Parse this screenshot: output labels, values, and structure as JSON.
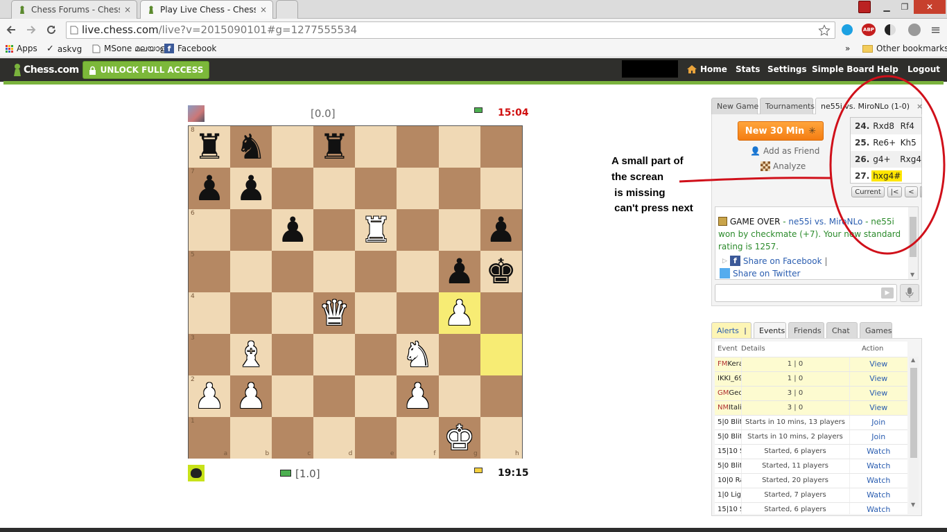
{
  "browser": {
    "tabs": [
      {
        "title": "Chess Forums - Chess.com",
        "close": "×"
      },
      {
        "title": "Play Live Chess - Chess.com",
        "close": "×"
      }
    ],
    "url_main": "live.chess.com",
    "url_rest": "/live?v=2015090101#g=1277555534",
    "window_min": "▁",
    "window_max": "❐",
    "window_close": "✕",
    "bookmarks": [
      "Apps",
      "askvg",
      "MSone മലയാളം",
      "Facebook"
    ],
    "overflow": "»",
    "other_bookmarks": "Other bookmarks"
  },
  "site": {
    "logo": "Chess.com",
    "unlock": "UNLOCK FULL ACCESS",
    "nav": [
      "Home",
      "Stats",
      "Settings",
      "Simple Board",
      "Help",
      "Logout"
    ]
  },
  "game": {
    "top_score": "[0.0]",
    "top_clock": "15:04",
    "bottom_score": "[1.0]",
    "bottom_clock": "19:15",
    "ranks": [
      "8",
      "7",
      "6",
      "5",
      "4",
      "3",
      "2",
      "1"
    ],
    "files": [
      "a",
      "b",
      "c",
      "d",
      "e",
      "f",
      "g",
      "h"
    ],
    "board": [
      [
        "r",
        "n",
        "",
        "r",
        "",
        "",
        "",
        ""
      ],
      [
        "p",
        "p",
        "",
        "",
        "",
        "",
        "",
        ""
      ],
      [
        "",
        "",
        "p",
        "",
        "R",
        "",
        "",
        "p"
      ],
      [
        "",
        "",
        "",
        "",
        "",
        "",
        "p",
        "k"
      ],
      [
        "",
        "",
        "",
        "Q",
        "",
        "",
        "P",
        ""
      ],
      [
        "",
        "B",
        "",
        "",
        "",
        "N",
        "",
        ""
      ],
      [
        "P",
        "P",
        "",
        "",
        "",
        "P",
        "",
        ""
      ],
      [
        "",
        "",
        "",
        "",
        "",
        "",
        "K",
        ""
      ]
    ],
    "highlight_squares": [
      "g4",
      "h3"
    ]
  },
  "panel": {
    "tabs": [
      "New Game",
      "Tournaments",
      "ne55i vs. MiroNLo (1-0)"
    ],
    "tab_close": "×",
    "new_button": "New 30 Min",
    "add_friend": "Add as Friend",
    "analyze": "Analyze",
    "moves": [
      {
        "n": "24.",
        "w": "Rxd8",
        "b": "Rf4"
      },
      {
        "n": "25.",
        "w": "Re6+",
        "b": "Kh5"
      },
      {
        "n": "26.",
        "w": "g4+",
        "b": "Rxg4"
      },
      {
        "n": "27.",
        "w": "hxg4#",
        "b": ""
      }
    ],
    "nav_current": "Current",
    "nav_first": "|<",
    "nav_prev": "<",
    "chat_game_over": "GAME OVER",
    "chat_dash": " - ",
    "chat_players": "ne55i vs. MiroNLo",
    "chat_result": " - ne55i won by checkmate (+7). Your new standard rating is 1257.",
    "share_facebook": "Share on Facebook",
    "share_sep": "|",
    "share_twitter": "Share on Twitter"
  },
  "events": {
    "tabs": [
      "Alerts",
      "Events",
      "Friends",
      "Chat",
      "Games"
    ],
    "headers": [
      "Event",
      "Details",
      "Action"
    ],
    "rows": [
      {
        "title": "FM",
        "name": "Kera",
        "details": "1 | 0",
        "action": "View",
        "hl": true
      },
      {
        "title": "",
        "name": "IKKI_69",
        "details": "1 | 0",
        "action": "View",
        "hl": true
      },
      {
        "title": "GM",
        "name": "Geo",
        "details": "3 | 0",
        "action": "View",
        "hl": true
      },
      {
        "title": "NM",
        "name": "Itali",
        "details": "3 | 0",
        "action": "View",
        "hl": true
      },
      {
        "title": "",
        "name": "5|0 Blit",
        "details": "Starts in 10 mins, 13 players",
        "action": "Join",
        "hl": false
      },
      {
        "title": "",
        "name": "5|0 Blit",
        "details": "Starts in 10 mins, 2 players",
        "action": "Join",
        "hl": false
      },
      {
        "title": "",
        "name": "15|10 S",
        "details": "Started, 6 players",
        "action": "Watch",
        "hl": false
      },
      {
        "title": "",
        "name": "5|0 Blit",
        "details": "Started, 11 players",
        "action": "Watch",
        "hl": false
      },
      {
        "title": "",
        "name": "10|0 Ra",
        "details": "Started, 20 players",
        "action": "Watch",
        "hl": false
      },
      {
        "title": "",
        "name": "1|0 Ligi",
        "details": "Started, 7 players",
        "action": "Watch",
        "hl": false
      },
      {
        "title": "",
        "name": "15|10 S",
        "details": "Started, 6 players",
        "action": "Watch",
        "hl": false
      }
    ]
  },
  "annotation": {
    "lines": [
      "A small part of",
      "the screan",
      " is missing",
      " can't press next"
    ],
    "color": "#d0101a"
  }
}
